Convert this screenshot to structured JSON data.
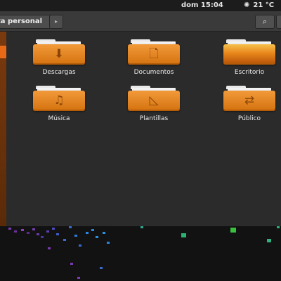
{
  "top_panel": {
    "clock": "dom 15:04",
    "weather": "21 °C"
  },
  "toolbar": {
    "breadcrumb": "ta personal",
    "next_icon": "▸",
    "search_icon": "🔍"
  },
  "folders": [
    {
      "label": "Descargas",
      "icon": "download-icon",
      "glyph": "⬇"
    },
    {
      "label": "Documentos",
      "icon": "document-icon",
      "glyph": "🗋"
    },
    {
      "label": "Escritorio",
      "icon": "desktop-icon",
      "glyph": ""
    },
    {
      "label": "Música",
      "icon": "music-icon",
      "glyph": "♫"
    },
    {
      "label": "Plantillas",
      "icon": "template-icon",
      "glyph": "📐"
    },
    {
      "label": "Público",
      "icon": "share-icon",
      "glyph": "⇄"
    }
  ],
  "colors": {
    "accent": "#e86a16",
    "folder": "#e78a2a",
    "panel": "#1c1c1c"
  }
}
